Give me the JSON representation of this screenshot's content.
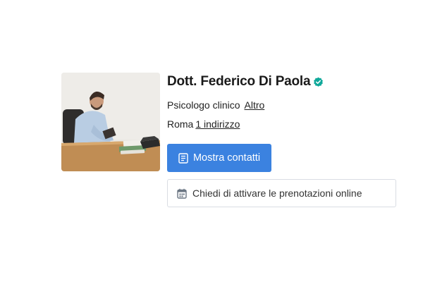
{
  "doctor": {
    "name": "Dott. Federico Di Paola",
    "verified_icon": "verified-check-icon",
    "specialty": "Psicologo clinico",
    "specialty_more": "Altro",
    "city": "Roma",
    "addresses_link": "1 indirizzo"
  },
  "actions": {
    "show_contacts_label": "Mostra contatti",
    "show_contacts_icon": "contact-card-icon",
    "request_booking_label": "Chiedi di attivare le prenotazioni online",
    "request_booking_icon": "calendar-icon"
  },
  "colors": {
    "primary": "#3b82e0",
    "verified": "#10a89a",
    "border": "#d9dde3"
  }
}
